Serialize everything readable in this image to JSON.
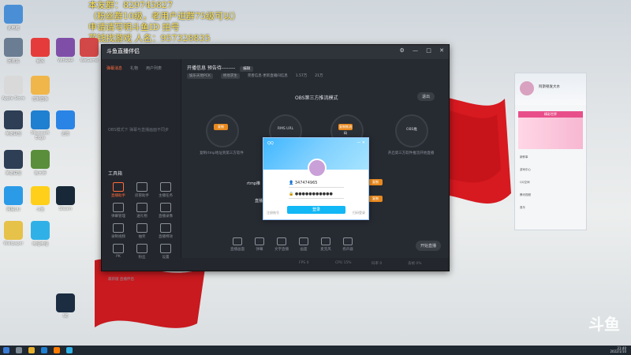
{
  "overlay": {
    "line1": "本友群：829745827",
    "line2": "（粉丝群10级，老用户进群75级可以）",
    "line3": "申请请写明斗鱼ID 拍号",
    "line4": "花钱找游戏 人名：957328835"
  },
  "desktop_icons": [
    {
      "label": "此电脑",
      "color": "#4a8fd6"
    },
    {
      "label": "回收站",
      "color": "#6a7d92"
    },
    {
      "label": "Apple Store",
      "color": "#d9d9d9"
    },
    {
      "label": "英雄联盟",
      "color": "#2d3e55"
    },
    {
      "label": "英雄联盟",
      "color": "#2d3e55"
    },
    {
      "label": "控制面板",
      "color": "#f0b64a"
    },
    {
      "label": "Microsoft Edge",
      "color": "#1f7fd0"
    },
    {
      "label": "迅雷",
      "color": "#2a84e6"
    },
    {
      "label": "网易UU",
      "color": "#2b9be7"
    },
    {
      "label": "暴风",
      "color": "#e63b3b"
    },
    {
      "label": "鲁大师",
      "color": "#5a8e3b"
    },
    {
      "label": "WinRAR",
      "color": "#7f4fa8"
    },
    {
      "label": "WeGame",
      "color": "#d24747"
    },
    {
      "label": "斗鱼",
      "color": "#ffcf1a"
    },
    {
      "label": "哔哩哔哩",
      "color": "#2fb1e7"
    },
    {
      "label": "Steam",
      "color": "#182838"
    },
    {
      "label": "5E",
      "color": "#1c2d42"
    },
    {
      "label": "Wallpaper",
      "color": "#e6c24a"
    }
  ],
  "app": {
    "logo": "斗鱼直播伴侣",
    "title_main": "开播信息 预告待--------",
    "title_badge": "编辑",
    "subhead": [
      "娱乐天地PCK",
      "绝地求生",
      "完善信息·更新直播间信息",
      "1.57万",
      "21万"
    ],
    "sidebar_tabs": [
      "弹幕消息",
      "礼物",
      "用户列表"
    ],
    "sidebar_hint": "OBS模式下 弹幕与直播画面不同步",
    "tools_heading": "工具箱",
    "tools": [
      {
        "label": "直播助手",
        "active": true
      },
      {
        "label": "房管助手",
        "active": false
      },
      {
        "label": "主播任务",
        "active": false
      },
      {
        "label": "弹幕管理",
        "active": false
      },
      {
        "label": "送礼物",
        "active": false
      },
      {
        "label": "直播录像",
        "active": false
      },
      {
        "label": "录制视频",
        "active": false
      },
      {
        "label": "抽奖",
        "active": false
      },
      {
        "label": "直播特效",
        "active": false
      },
      {
        "label": "PK",
        "active": false
      },
      {
        "label": "粉丝",
        "active": false
      },
      {
        "label": "设置",
        "active": false
      }
    ],
    "mode_title": "OBS第三方推流模式",
    "exit_label": "退出",
    "steps": [
      {
        "num": "1",
        "btn": "复制",
        "label": "复制rtmp地址到第三方软件"
      },
      {
        "num": "2",
        "btn": "",
        "label": "RMS URL"
      },
      {
        "num": "3",
        "btn": "复制推流码",
        "label": ""
      },
      {
        "num": "4",
        "btn": "",
        "label": "开启第三方软件推流开始直播"
      }
    ],
    "step4_text": "OBS推",
    "rtmp_label": "rtmp推",
    "stream_label": "直播",
    "bottom_tools": [
      "直播画面",
      "弹幕",
      "文字直播",
      "画面",
      "麦克风",
      "扬声器"
    ],
    "start_live": "开始直播",
    "bottom_left": "最新版 直播伴侣",
    "status_items": [
      "FPS 0",
      "CPU 15%",
      "码率 0",
      "丢帧 0%"
    ]
  },
  "qq_login": {
    "title": "QQ",
    "account": "347474965",
    "password": "●●●●●●●●●●●",
    "login_btn": "登录",
    "register": "注册账号",
    "qr": "扫码登录"
  },
  "qq_panel": {
    "name": "阿斯顿发大水",
    "banner": "精彩世界",
    "rows": [
      "新鲜事",
      "游戏中心",
      "QQ空间",
      "腾讯视频",
      "音乐"
    ]
  },
  "taskbar": {
    "time": "21:40",
    "date": "2022/1/10"
  },
  "watermark": "斗鱼"
}
